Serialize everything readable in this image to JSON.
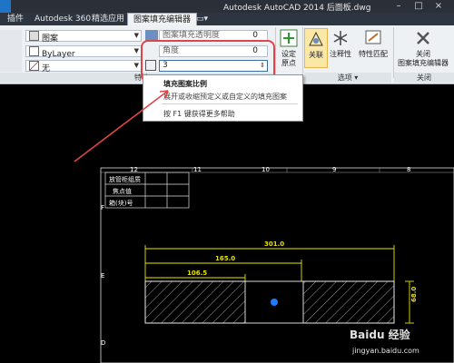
{
  "window": {
    "title": "Autodesk AutoCAD 2014    后面板.dwg"
  },
  "tabs": [
    {
      "label": "插件"
    },
    {
      "label": "Autodesk 360"
    },
    {
      "label": "精选应用"
    },
    {
      "label": "图案填充编辑器"
    },
    {
      "label": "▭▾"
    }
  ],
  "ribbon": {
    "properties": {
      "pattern_label": "图案",
      "layer_value": "ByLayer",
      "bg_value": "无",
      "transparency_label": "图案填充透明度",
      "transparency_value": "0",
      "angle_label": "角度",
      "angle_value": "0",
      "scale_value": "3",
      "panel_label": "特性 ▾"
    },
    "origin_button": "设定\n原点",
    "origin_label1": "设定",
    "origin_label2": "原点",
    "associative_button": "关联",
    "annotative_button": "注释性",
    "match_label1": "特性匹配",
    "options_panel": "选项 ▾",
    "close_label1": "关闭",
    "close_label2": "图案填充编辑器",
    "close_panel": "关闭"
  },
  "tooltip": {
    "title": "填充图案比例",
    "description": "展开或收缩预定义或自定义的填充图案",
    "help": "按 F1 键获得更多帮助"
  },
  "drawing": {
    "table_rows": [
      "放管柜组质",
      "焦点值",
      "箱(块)号"
    ],
    "ruler_numbers": [
      "12",
      "11",
      "10",
      "9",
      "8"
    ],
    "side_letters": [
      "F",
      "E",
      "D"
    ],
    "dim_total": "301.0",
    "dim_mid": "165.0",
    "dim_left": "106.5",
    "dim_height": "68.0"
  },
  "watermark": {
    "brand": "Baidu 经验",
    "url": "jingyan.baidu.com"
  },
  "colors": {
    "dimension": "#e8e400",
    "accent_red": "#e0454a",
    "dot_blue": "#1e7bff"
  }
}
